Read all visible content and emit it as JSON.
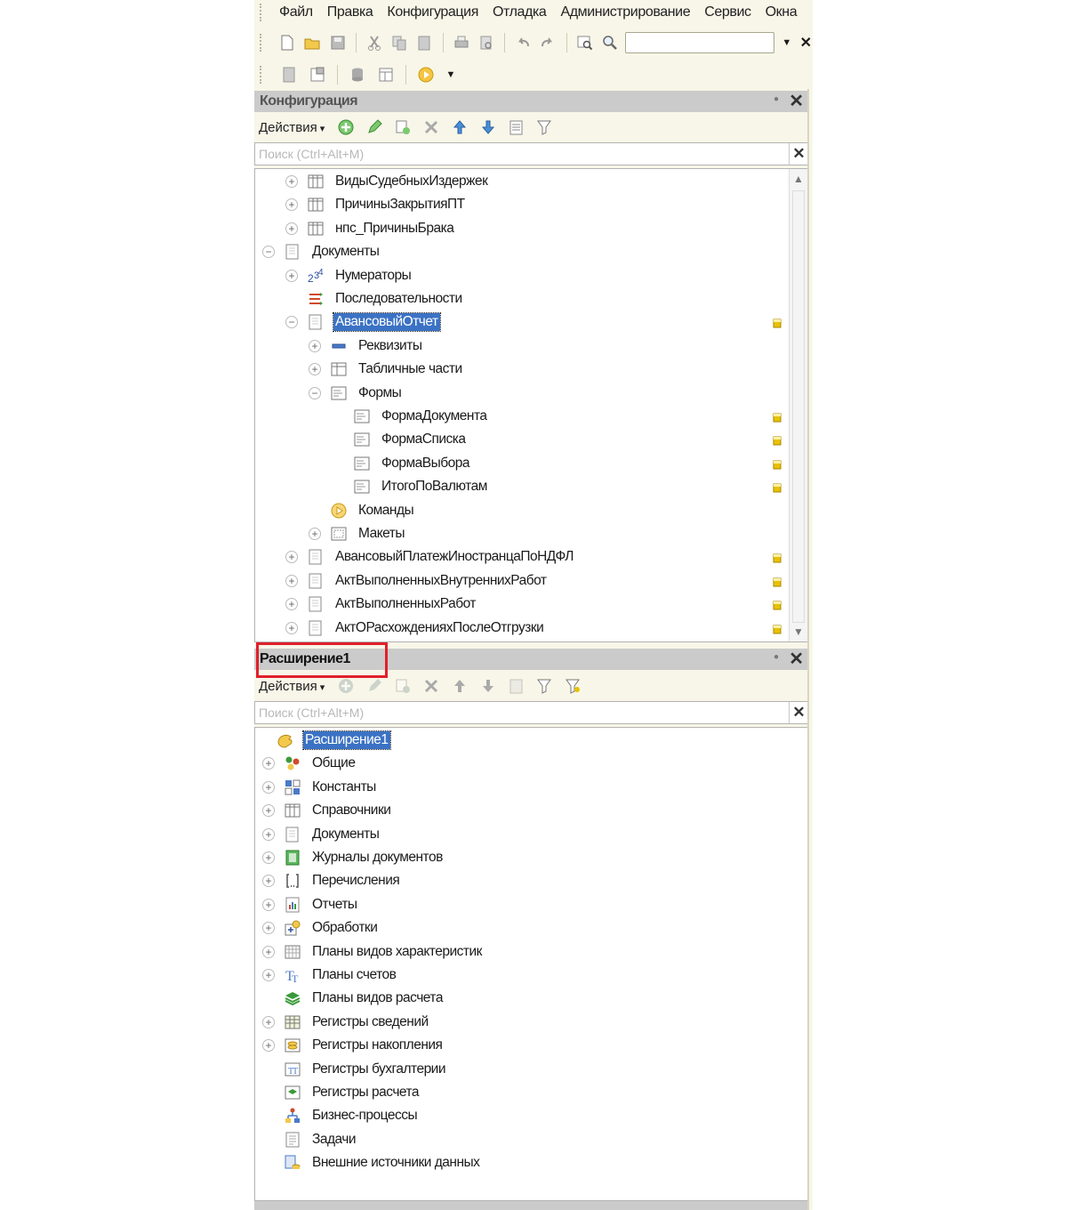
{
  "menu": [
    "Файл",
    "Правка",
    "Конфигурация",
    "Отладка",
    "Администрирование",
    "Сервис",
    "Окна"
  ],
  "toolbar": {
    "search_value": ""
  },
  "config_panel": {
    "title": "Конфигурация",
    "actions_label": "Действия",
    "search_placeholder": "Поиск (Ctrl+Alt+M)",
    "items": [
      {
        "label": "ВидыСудебныхИздержек",
        "level": 1,
        "expander": "plus",
        "icon": "catalog-icon",
        "marker": false
      },
      {
        "label": "ПричиныЗакрытияПТ",
        "level": 1,
        "expander": "plus",
        "icon": "catalog-icon",
        "marker": false
      },
      {
        "label": "нпс_ПричиныБрака",
        "level": 1,
        "expander": "plus",
        "icon": "catalog-icon",
        "marker": false
      },
      {
        "label": "Документы",
        "level": 0,
        "expander": "minus",
        "icon": "document-icon",
        "marker": false
      },
      {
        "label": "Нумераторы",
        "level": 1,
        "expander": "plus",
        "icon": "numerator-icon",
        "marker": false
      },
      {
        "label": "Последовательности",
        "level": 1,
        "expander": "none",
        "icon": "sequence-icon",
        "marker": false
      },
      {
        "label": "АвансовыйОтчет",
        "level": 1,
        "expander": "minus",
        "icon": "document-icon",
        "marker": true,
        "selected": true
      },
      {
        "label": "Реквизиты",
        "level": 2,
        "expander": "plus",
        "icon": "attribute-icon",
        "marker": false
      },
      {
        "label": "Табличные части",
        "level": 2,
        "expander": "plus",
        "icon": "table-icon",
        "marker": false
      },
      {
        "label": "Формы",
        "level": 2,
        "expander": "minus",
        "icon": "form-icon",
        "marker": false
      },
      {
        "label": "ФормаДокумента",
        "level": 3,
        "expander": "none",
        "icon": "form-icon",
        "marker": true
      },
      {
        "label": "ФормаСписка",
        "level": 3,
        "expander": "none",
        "icon": "form-icon",
        "marker": true
      },
      {
        "label": "ФормаВыбора",
        "level": 3,
        "expander": "none",
        "icon": "form-icon",
        "marker": true
      },
      {
        "label": "ИтогоПоВалютам",
        "level": 3,
        "expander": "none",
        "icon": "form-icon",
        "marker": true
      },
      {
        "label": "Команды",
        "level": 2,
        "expander": "none",
        "icon": "command-icon",
        "marker": false
      },
      {
        "label": "Макеты",
        "level": 2,
        "expander": "plus",
        "icon": "template-icon",
        "marker": false
      },
      {
        "label": "АвансовыйПлатежИностранцаПоНДФЛ",
        "level": 1,
        "expander": "plus",
        "icon": "document-icon",
        "marker": true
      },
      {
        "label": "АктВыполненныхВнутреннихРабот",
        "level": 1,
        "expander": "plus",
        "icon": "document-icon",
        "marker": true
      },
      {
        "label": "АктВыполненныхРабот",
        "level": 1,
        "expander": "plus",
        "icon": "document-icon",
        "marker": true
      },
      {
        "label": "АктОРасхожденияхПослеОтгрузки",
        "level": 1,
        "expander": "plus",
        "icon": "document-icon",
        "marker": true
      }
    ]
  },
  "ext_panel": {
    "title": "Расширение1",
    "actions_label": "Действия",
    "search_placeholder": "Поиск (Ctrl+Alt+M)",
    "root": "Расширение1",
    "items": [
      {
        "label": "Общие",
        "expander": "plus",
        "icon": "common-icon"
      },
      {
        "label": "Константы",
        "expander": "plus",
        "icon": "constants-icon"
      },
      {
        "label": "Справочники",
        "expander": "plus",
        "icon": "catalog-icon"
      },
      {
        "label": "Документы",
        "expander": "plus",
        "icon": "document-icon"
      },
      {
        "label": "Журналы документов",
        "expander": "plus",
        "icon": "journal-icon"
      },
      {
        "label": "Перечисления",
        "expander": "plus",
        "icon": "enum-icon"
      },
      {
        "label": "Отчеты",
        "expander": "plus",
        "icon": "report-icon"
      },
      {
        "label": "Обработки",
        "expander": "plus",
        "icon": "processing-icon"
      },
      {
        "label": "Планы видов характеристик",
        "expander": "plus",
        "icon": "chart-of-characteristics-icon"
      },
      {
        "label": "Планы счетов",
        "expander": "plus",
        "icon": "chart-of-accounts-icon"
      },
      {
        "label": "Планы видов расчета",
        "expander": "none",
        "icon": "calculation-types-icon"
      },
      {
        "label": "Регистры сведений",
        "expander": "plus",
        "icon": "info-register-icon"
      },
      {
        "label": "Регистры накопления",
        "expander": "plus",
        "icon": "accumulation-register-icon"
      },
      {
        "label": "Регистры бухгалтерии",
        "expander": "none",
        "icon": "accounting-register-icon"
      },
      {
        "label": "Регистры расчета",
        "expander": "none",
        "icon": "calculation-register-icon"
      },
      {
        "label": "Бизнес-процессы",
        "expander": "none",
        "icon": "business-process-icon"
      },
      {
        "label": "Задачи",
        "expander": "none",
        "icon": "task-icon"
      },
      {
        "label": "Внешние источники данных",
        "expander": "none",
        "icon": "external-data-icon"
      }
    ]
  },
  "colors": {
    "selection": "#3b72c4",
    "highlight_box": "#e0202a",
    "panel_header": "#cbcbcb",
    "marker": "#e8c200"
  }
}
